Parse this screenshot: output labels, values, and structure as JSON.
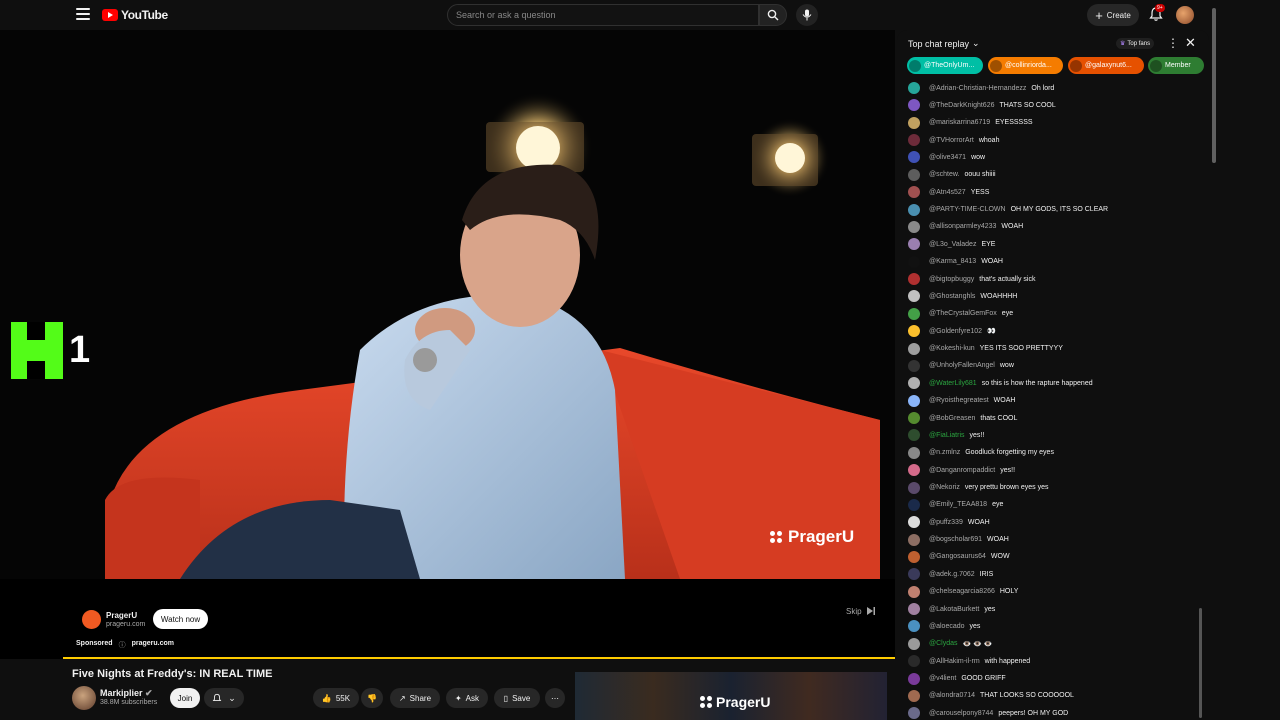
{
  "header": {
    "logo_text": "YouTube",
    "search_placeholder": "Search or ask a question",
    "create_label": "Create",
    "notif_count": "9+"
  },
  "video": {
    "kick_counter": "1",
    "watermark": "PragerU"
  },
  "ad": {
    "advertiser": "PragerU",
    "advertiser_url": "prageru.com",
    "cta": "Watch now",
    "skip_label": "Skip",
    "sponsored_label": "Sponsored",
    "sponsored_url": "prageru.com",
    "progress_fraction": 1.0
  },
  "info": {
    "title": "Five Nights at Freddy's: IN REAL TIME",
    "channel": "Markiplier",
    "subscribers": "38.8M subscribers",
    "join": "Join",
    "likes": "55K",
    "share": "Share",
    "ask": "Ask",
    "save": "Save",
    "thumb_watermark": "PragerU"
  },
  "chat": {
    "header": "Top chat replay",
    "top_fans": "Top fans",
    "chips": [
      {
        "label": "@TheOnlyUm...",
        "color": "#00bfa5"
      },
      {
        "label": "@collinriorda...",
        "color": "#f57c00"
      },
      {
        "label": "@galaxynut6...",
        "color": "#e65100"
      },
      {
        "label": "Member",
        "color": "#2e7d32"
      }
    ],
    "messages": [
      {
        "user": "@Adrian-Christian-Hernandezz",
        "text": "Oh lord",
        "avatar": "#26a69a",
        "member": false
      },
      {
        "user": "@TheDarkKnight626",
        "text": "THATS SO COOL",
        "avatar": "#7e57c2",
        "member": false
      },
      {
        "user": "@mariskarrina6719",
        "text": "EYESSSSS",
        "avatar": "#c0a060",
        "member": false
      },
      {
        "user": "@TVHorrorArt",
        "text": "whoah",
        "avatar": "#6d2b3a",
        "member": false
      },
      {
        "user": "@olive3471",
        "text": "wow",
        "avatar": "#3f51b5",
        "member": false
      },
      {
        "user": "@schtew.",
        "text": "oouu shiiii",
        "avatar": "#5d5d5d",
        "member": false
      },
      {
        "user": "@Atn4s527",
        "text": "YESS",
        "avatar": "#a05050",
        "member": false
      },
      {
        "user": "@PARTY-TIME-CLOWN",
        "text": "OH MY GODS, ITS SO CLEAR",
        "avatar": "#4a8fb0",
        "member": false
      },
      {
        "user": "@allisonparmley4233",
        "text": "WOAH",
        "avatar": "#8a8a8a",
        "member": false
      },
      {
        "user": "@L3o_Valadez",
        "text": "EYE",
        "avatar": "#9a7fb0",
        "member": false
      },
      {
        "user": "@Karma_8413",
        "text": "WOAH",
        "avatar": "#111111",
        "member": false
      },
      {
        "user": "@bigtopbuggy",
        "text": "that's actually sick",
        "avatar": "#b03030",
        "member": false
      },
      {
        "user": "@Ghostanghls",
        "text": "WOAHHHH",
        "avatar": "#c0c0c0",
        "member": false
      },
      {
        "user": "@TheCrystalGemFox",
        "text": "eye",
        "avatar": "#43a047",
        "member": false
      },
      {
        "user": "@Goldenfyre102",
        "text": "👀",
        "avatar": "#fbc02d",
        "member": false
      },
      {
        "user": "@Kokeshi-kun",
        "text": "YES ITS SOO PRETTYYY",
        "avatar": "#9e9e9e",
        "member": false
      },
      {
        "user": "@UnholyFallenAngel",
        "text": "wow",
        "avatar": "#333333",
        "member": false
      },
      {
        "user": "@WaterLily681",
        "text": "so this is how the rapture happened",
        "avatar": "#b0b0b0",
        "member": true
      },
      {
        "user": "@Ryoisthegreatest",
        "text": "WOAH",
        "avatar": "#8ab4f8",
        "member": false
      },
      {
        "user": "@BobGreasen",
        "text": "thats COOL",
        "avatar": "#558b2f",
        "member": false
      },
      {
        "user": "@FiaLiatris",
        "text": "yes!!",
        "avatar": "#2e4d2e",
        "member": true
      },
      {
        "user": "@n.zmlnz",
        "text": "Goodluck forgetting my eyes",
        "avatar": "#888888",
        "member": false
      },
      {
        "user": "@Danganrompaddict",
        "text": "yes!!",
        "avatar": "#d46a8a",
        "member": false
      },
      {
        "user": "@Nekoriz",
        "text": "very prettu brown eyes yes",
        "avatar": "#5a4a6a",
        "member": false
      },
      {
        "user": "@Emily_TEAA818",
        "text": "eye",
        "avatar": "#1a2a4a",
        "member": false
      },
      {
        "user": "@puffz339",
        "text": "WOAH",
        "avatar": "#dcdcdc",
        "member": false
      },
      {
        "user": "@bogscholar691",
        "text": "WOAH",
        "avatar": "#8d6e63",
        "member": false
      },
      {
        "user": "@Gangosaurus64",
        "text": "WOW",
        "avatar": "#bf6030",
        "member": false
      },
      {
        "user": "@adek.g.7062",
        "text": "IRIS",
        "avatar": "#3a3a5a",
        "member": false
      },
      {
        "user": "@chelseagarcia8266",
        "text": "HOLY",
        "avatar": "#c08070",
        "member": false
      },
      {
        "user": "@LakotaBurkett",
        "text": "yes",
        "avatar": "#a080a0",
        "member": false
      },
      {
        "user": "@aloecado",
        "text": "yes",
        "avatar": "#4a90c0",
        "member": false
      },
      {
        "user": "@Clydas",
        "text": "👁️ 👁️ 👁️",
        "avatar": "#9a9a9a",
        "member": true
      },
      {
        "user": "@AllHakim-il-rm",
        "text": "with happened",
        "avatar": "#2a2a2a",
        "member": false
      },
      {
        "user": "@v4lient",
        "text": "GOOD GRIFF",
        "avatar": "#7a3a9a",
        "member": false
      },
      {
        "user": "@alondra0714",
        "text": "THAT LOOKS SO COOOOOL",
        "avatar": "#a06a50",
        "member": false
      },
      {
        "user": "@carouselpony8744",
        "text": "peepers! OH MY GOD",
        "avatar": "#6a6a8a",
        "member": false
      }
    ]
  }
}
